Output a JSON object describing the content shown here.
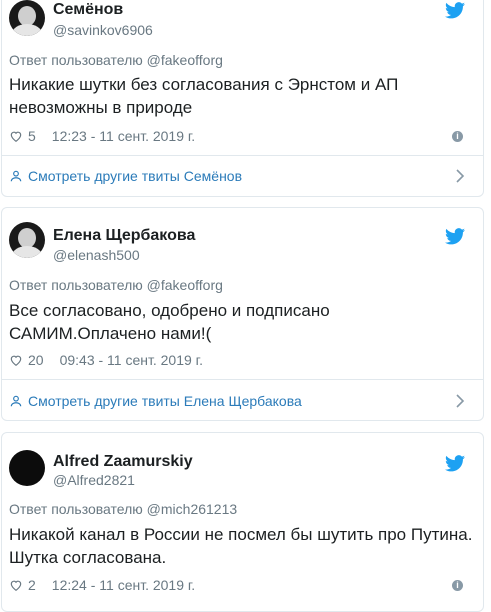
{
  "tweets": [
    {
      "name": "Семёнов",
      "handle": "@savinkov6906",
      "reply_to": "Ответ пользователю @fakeofforg",
      "text": "Никакие шутки без согласования с Эрнстом и АП невозможны в природе",
      "likes": "5",
      "time": "12:23 - 11 сент. 2019 г.",
      "more": "Смотреть другие твиты Семёнов"
    },
    {
      "name": "Елена Щербакова",
      "handle": "@elenash500",
      "reply_to": "Ответ пользователю @fakeofforg",
      "text": "Все согласовано, одобрено и подписано САМИМ.Оплачено нами!(",
      "likes": "20",
      "time": "09:43 - 11 сент. 2019 г.",
      "more": "Смотреть другие твиты Елена Щербакова"
    },
    {
      "name": "Alfred Zaamurskiy",
      "handle": "@Alfred2821",
      "reply_to": "Ответ пользователю @mich261213",
      "text": "Никакой канал в России не посмел бы шутить про Путина. Шутка согласована.",
      "likes": "2",
      "time": "12:24 - 11 сент. 2019 г."
    }
  ],
  "colors": {
    "twitter_blue": "#1da1f2",
    "link": "#2b7bb9",
    "muted": "#697882",
    "border": "#e1e8ed"
  },
  "icons": {
    "bird": "twitter-bird-icon",
    "heart": "heart-icon",
    "info": "info-icon",
    "person": "person-icon",
    "chevron": "chevron-right-icon"
  }
}
